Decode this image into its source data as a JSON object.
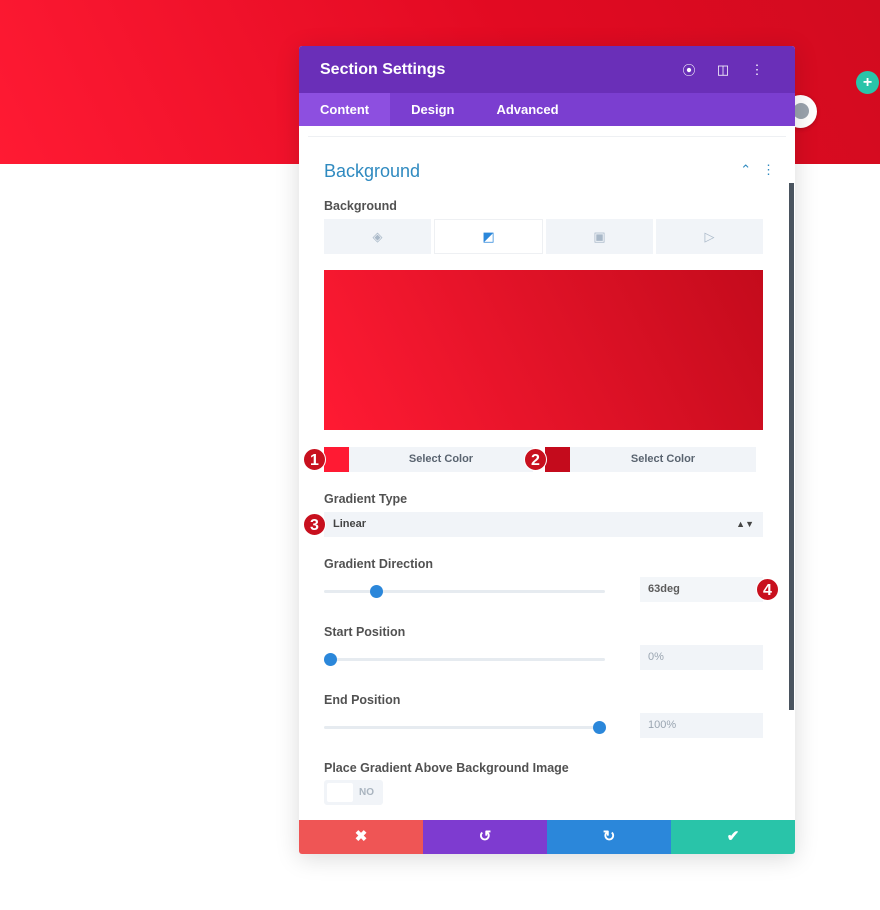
{
  "colors": {
    "hero": "#e20a22",
    "header": "#6a2fb8",
    "tabs": "#7b3ed0",
    "accent": "#2b87da",
    "color1": "#ff1a33",
    "color2": "#c40b1c",
    "cancel": "#ef5555",
    "undo": "#7e3bd0",
    "redo": "#2b87da",
    "save": "#29c4a9"
  },
  "panel": {
    "title": "Section Settings",
    "header_icons": [
      "focus-icon",
      "split-view-icon",
      "more-vertical-icon"
    ],
    "tabs": [
      {
        "label": "Content",
        "active": true
      },
      {
        "label": "Design"
      },
      {
        "label": "Advanced"
      }
    ]
  },
  "background": {
    "section_title": "Background",
    "field_label": "Background",
    "type_tabs": [
      "paint-bucket-icon",
      "gradient-icon",
      "image-icon",
      "video-icon"
    ],
    "active_type": "gradient",
    "color1": {
      "badge": "1",
      "label": "Select Color"
    },
    "color2": {
      "badge": "2",
      "label": "Select Color"
    },
    "gradient_type": {
      "label": "Gradient Type",
      "badge": "3",
      "value": "Linear"
    },
    "gradient_direction": {
      "label": "Gradient Direction",
      "value": "63deg",
      "badge": "4",
      "slider_value": 63,
      "slider_max": 360
    },
    "start_position": {
      "label": "Start Position",
      "value": "0%",
      "slider_percent": 0
    },
    "end_position": {
      "label": "End Position",
      "value": "100%",
      "slider_percent": 100
    },
    "place_above": {
      "label": "Place Gradient Above Background Image",
      "value": "NO"
    }
  },
  "footer": {
    "cancel": "✖",
    "undo": "↺",
    "redo": "↻",
    "save": "✔"
  }
}
